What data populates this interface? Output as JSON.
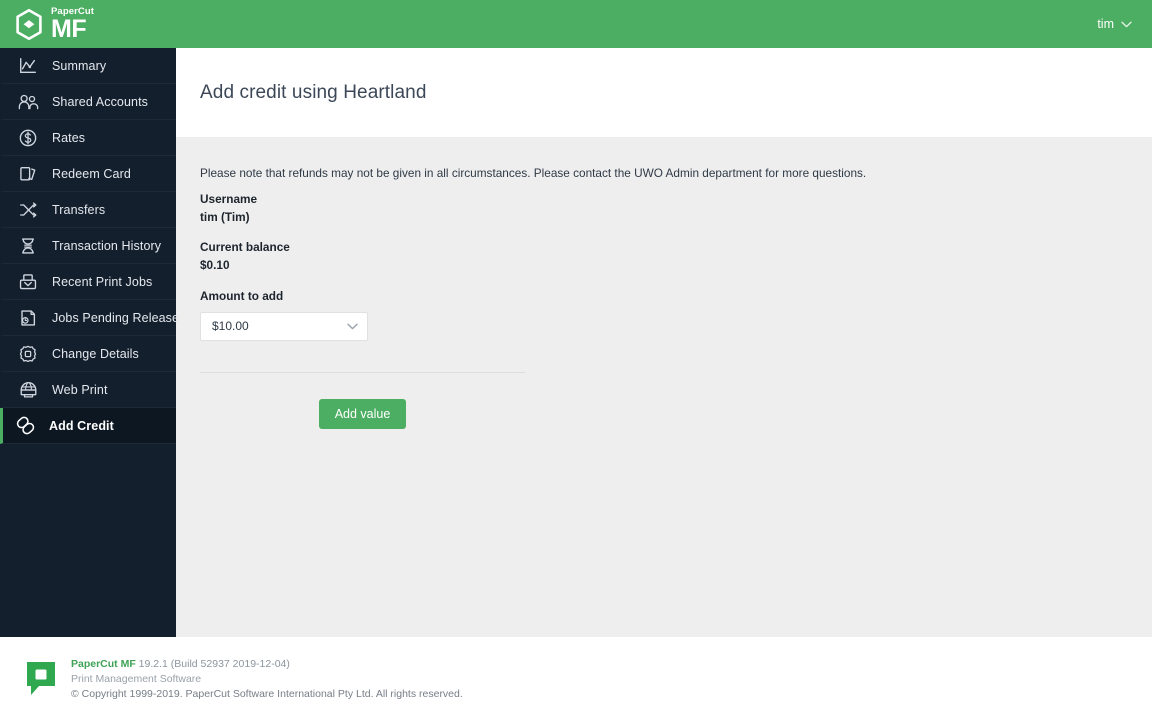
{
  "header": {
    "brand_top": "PaperCut",
    "brand_main": "MF",
    "logo_icon": "papercut-hexagon-logo",
    "user_name": "tim",
    "user_chevron_icon": "chevron-down-icon"
  },
  "sidebar": {
    "items": [
      {
        "label": "Summary",
        "icon": "chart-line-icon",
        "active": false
      },
      {
        "label": "Shared Accounts",
        "icon": "users-group-icon",
        "active": false
      },
      {
        "label": "Rates",
        "icon": "dollar-circle-icon",
        "active": false
      },
      {
        "label": "Redeem Card",
        "icon": "cards-icon",
        "active": false
      },
      {
        "label": "Transfers",
        "icon": "shuffle-arrows-icon",
        "active": false
      },
      {
        "label": "Transaction History",
        "icon": "hourglass-icon",
        "active": false
      },
      {
        "label": "Recent Print Jobs",
        "icon": "printer-tray-icon",
        "active": false
      },
      {
        "label": "Jobs Pending Release",
        "icon": "document-clock-icon",
        "active": false
      },
      {
        "label": "Change Details",
        "icon": "gear-icon",
        "active": false
      },
      {
        "label": "Web Print",
        "icon": "globe-print-icon",
        "active": false
      },
      {
        "label": "Add Credit",
        "icon": "chain-link-icon",
        "active": true
      }
    ]
  },
  "page": {
    "title": "Add credit using Heartland",
    "note": "Please note that refunds may not be given in all circumstances. Please contact the UWO Admin department for more questions.",
    "username_label": "Username",
    "username_value": "tim (Tim)",
    "balance_label": "Current balance",
    "balance_value": "$0.10",
    "amount_label": "Amount to add",
    "amount_selected": "$10.00",
    "amount_options": [
      "$10.00"
    ],
    "amount_chevron_icon": "chevron-down-icon",
    "submit_label": "Add value"
  },
  "footer": {
    "logo_icon": "papercut-bubble-logo",
    "product": "PaperCut MF",
    "version": " 19.2.1 (Build 52937 2019-12-04)",
    "tagline": "Print Management Software",
    "copyright": "© Copyright 1999-2019. PaperCut Software International Pty Ltd. All rights reserved."
  },
  "colors": {
    "brand_green": "#4cae62",
    "sidebar_bg": "#141f2e",
    "sidebar_active_bg": "#0d1722",
    "content_bg": "#eeeeef",
    "footer_green": "#2fa84f"
  }
}
